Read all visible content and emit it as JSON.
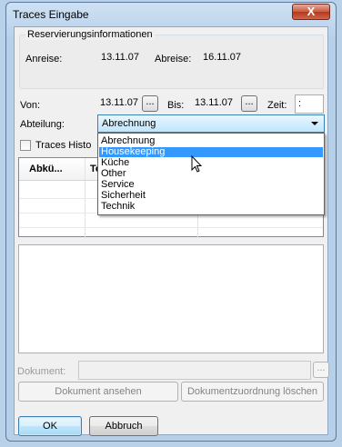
{
  "window": {
    "title": "Traces Eingabe",
    "close_glyph": "X"
  },
  "reservation": {
    "group_title": "Reservierungsinformationen",
    "arrival_label": "Anreise:",
    "arrival_value": "13.11.07",
    "departure_label": "Abreise:",
    "departure_value": "16.11.07"
  },
  "filter": {
    "from_label": "Von:",
    "from_value": "13.11.07",
    "to_label": "Bis:",
    "to_value": "13.11.07",
    "time_label": "Zeit:",
    "time_value": ":",
    "dots": "..."
  },
  "department": {
    "label": "Abteilung:",
    "selected": "Abrechnung",
    "options": [
      "Abrechnung",
      "Housekeeping",
      "Küche",
      "Other",
      "Service",
      "Sicherheit",
      "Technik"
    ],
    "highlighted_index": 1
  },
  "history": {
    "checkbox_label": "Traces Histo"
  },
  "grid": {
    "columns": [
      "Abkü...",
      "Te"
    ]
  },
  "document": {
    "label": "Dokument:",
    "value": "",
    "browse": "...",
    "view_button": "Dokument ansehen",
    "delete_button": "Dokumentzuordnung löschen"
  },
  "footer": {
    "ok": "OK",
    "cancel": "Abbruch"
  },
  "colors": {
    "accent": "#3399ff",
    "close": "#c75a3f"
  }
}
